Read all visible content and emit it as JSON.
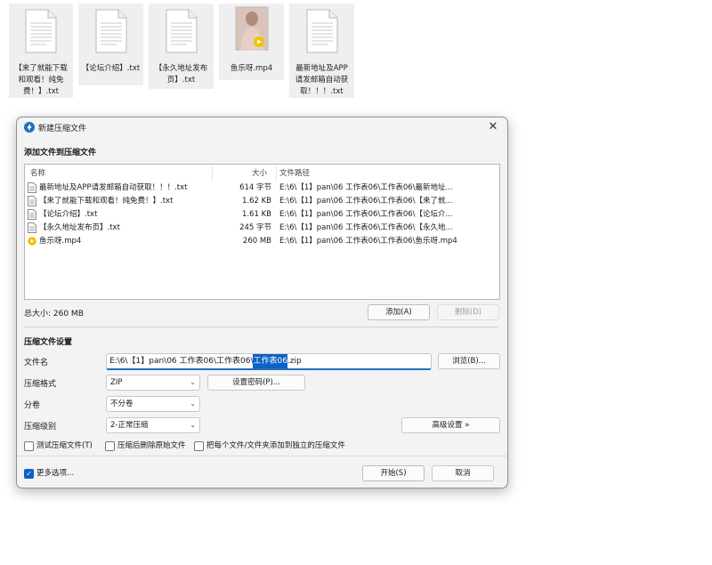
{
  "desktop_files": [
    {
      "name": "【来了就能下载和观看！纯免费！】.txt",
      "lines": [
        "【来了就能下载",
        "和观看！纯免",
        "费！】.txt"
      ],
      "kind": "txt"
    },
    {
      "name": "【论坛介绍】.txt",
      "lines": [
        "【论坛介绍】.txt"
      ],
      "kind": "txt"
    },
    {
      "name": "【永久地址发布页】.txt",
      "lines": [
        "【永久地址发布",
        "页】.txt"
      ],
      "kind": "txt"
    },
    {
      "name": "鱼乐呀.mp4",
      "lines": [
        "鱼乐呀.mp4"
      ],
      "kind": "video"
    },
    {
      "name": "最新地址及APP请发邮箱自动获取！！！.txt",
      "lines": [
        "最新地址及APP",
        "请发邮箱自动获",
        "取！！！.txt"
      ],
      "kind": "txt"
    }
  ],
  "dialog": {
    "title": "新建压缩文件",
    "close_icon": "close-icon",
    "add_section_title": "添加文件到压缩文件",
    "columns": {
      "name": "名称",
      "size": "大小",
      "path": "文件路径"
    },
    "files": [
      {
        "name": "最新地址及APP请发邮箱自动获取！！！.txt",
        "size": "614 字节",
        "path": "E:\\6\\【1】pan\\06 工作表06\\工作表06\\最新地址...",
        "kind": "txt"
      },
      {
        "name": "【来了就能下载和观看！纯免费！】.txt",
        "size": "1.62 KB",
        "path": "E:\\6\\【1】pan\\06 工作表06\\工作表06\\【来了就...",
        "kind": "txt"
      },
      {
        "name": "【论坛介绍】.txt",
        "size": "1.61 KB",
        "path": "E:\\6\\【1】pan\\06 工作表06\\工作表06\\【论坛介...",
        "kind": "txt"
      },
      {
        "name": "【永久地址发布页】.txt",
        "size": "245 字节",
        "path": "E:\\6\\【1】pan\\06 工作表06\\工作表06\\【永久地...",
        "kind": "txt"
      },
      {
        "name": "鱼乐呀.mp4",
        "size": "260 MB",
        "path": "E:\\6\\【1】pan\\06 工作表06\\工作表06\\鱼乐呀.mp4",
        "kind": "video"
      }
    ],
    "total_size": "总大小: 260 MB",
    "add_button": "添加(A)",
    "delete_button": "删除(D)",
    "settings_title": "压缩文件设置",
    "filename_label": "文件名",
    "filename_prefix": "E:\\6\\【1】pan\\06 工作表06\\工作表06\\",
    "filename_selected": "工作表06",
    "filename_suffix": ".zip",
    "browse_button": "浏览(B)...",
    "format_label": "压缩格式",
    "format_value": "ZIP",
    "password_button": "设置密码(P)...",
    "split_label": "分卷",
    "split_value": "不分卷",
    "level_label": "压缩级别",
    "level_value": "2-正常压缩",
    "advanced_button": "高级设置 »",
    "test_checkbox": "测试压缩文件(T)",
    "delete_source_checkbox": "压缩后删除原始文件",
    "separate_checkbox": "把每个文件/文件夹添加到独立的压缩文件",
    "more_options_checkbox": "更多选项...",
    "more_options_checked": true,
    "start_button": "开始(S)",
    "cancel_button": "取消",
    "accent_color": "#0b61c4"
  }
}
